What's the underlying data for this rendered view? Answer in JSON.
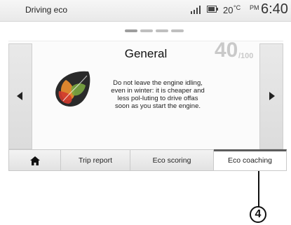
{
  "status_bar": {
    "title": "Driving eco",
    "temperature": "20",
    "temperature_unit": "°C",
    "ampm": "PM",
    "time": "6:40",
    "icons": [
      "signal-icon",
      "battery-icon"
    ]
  },
  "page_indicator": {
    "pages": 4,
    "active_index": 0
  },
  "panel": {
    "heading": "General",
    "score": "40",
    "score_max": "/100",
    "tip": "Do not leave the engine idling, even in winter: it is cheaper and less pol-luting to drive offas soon as you start the engine.",
    "icon": "eco-leaf-icon"
  },
  "tabs": [
    {
      "label": "",
      "icon": "home-icon"
    },
    {
      "label": "Trip report"
    },
    {
      "label": "Eco scoring"
    },
    {
      "label": "Eco coaching",
      "selected": true
    }
  ],
  "callout": {
    "number": "4"
  },
  "colors": {
    "score": "#c9c9c9",
    "selected_tab_indicator": "#5c5c5c",
    "leaf_dark": "#2a2a2a",
    "leaf_orange": "#e58a2e",
    "leaf_red": "#d23a2e",
    "leaf_green": "#7aa640"
  }
}
